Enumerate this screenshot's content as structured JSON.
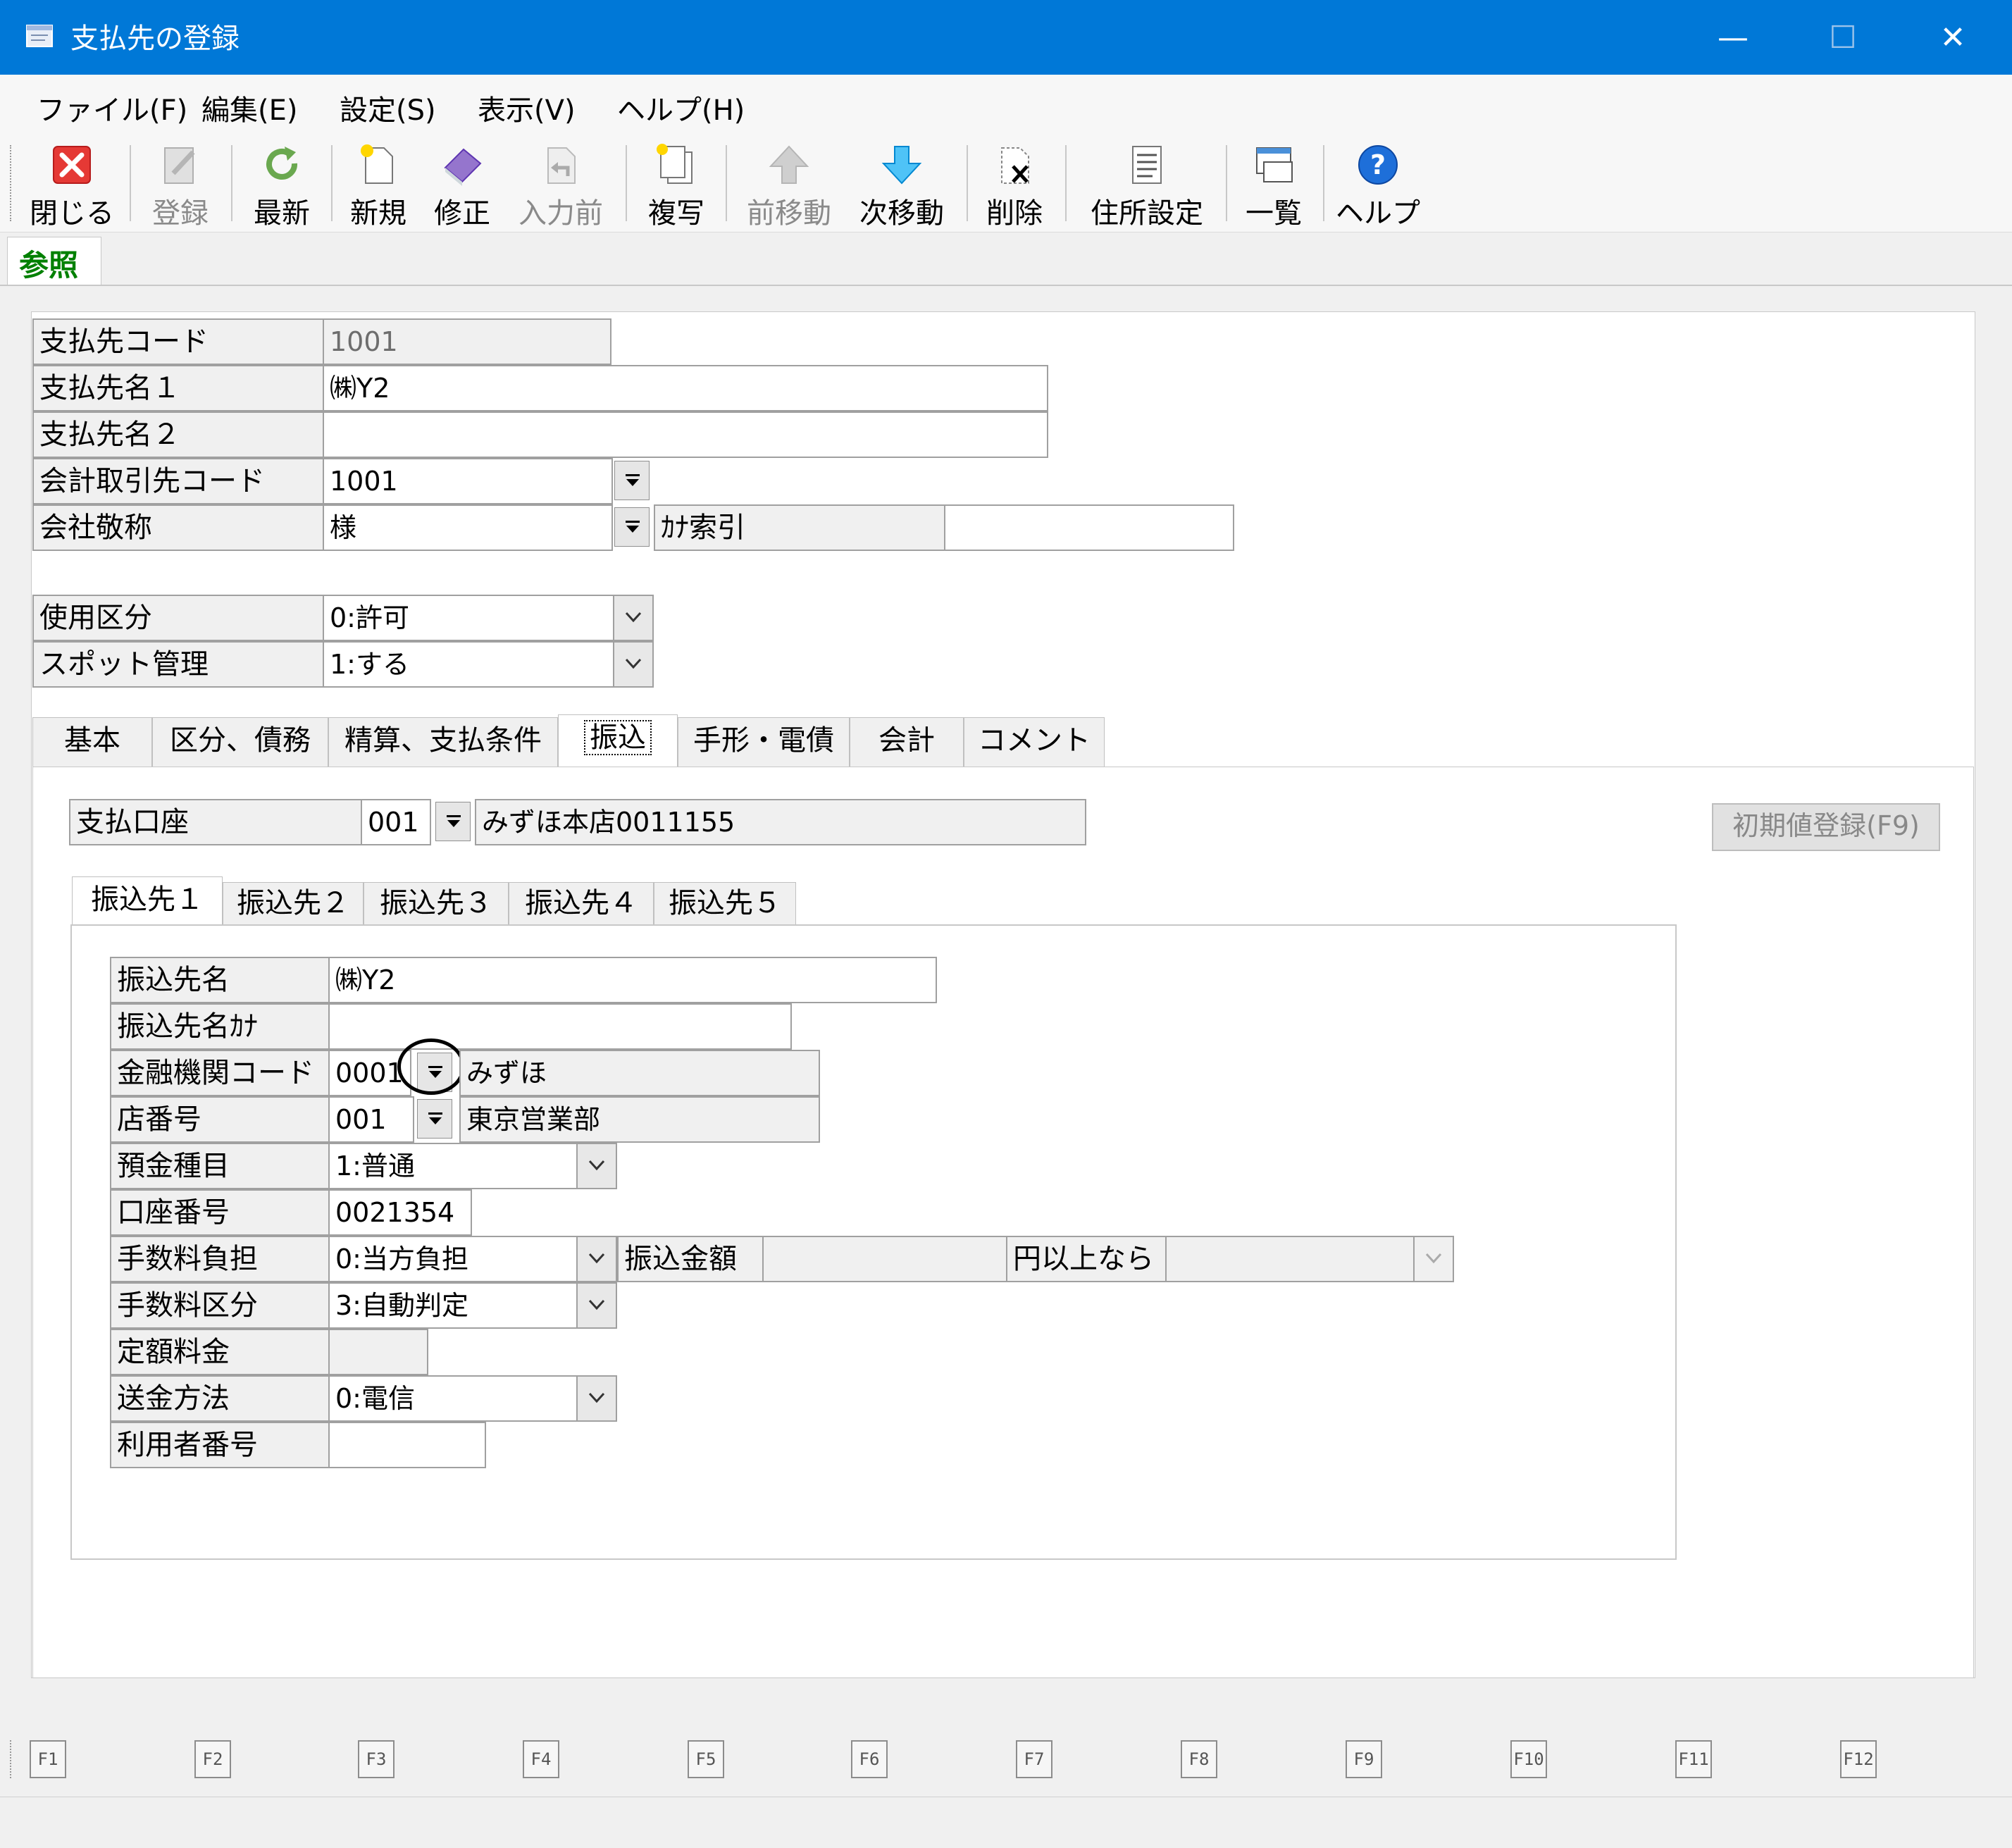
{
  "window": {
    "title": "支払先の登録",
    "minimize": "—",
    "maximize": "☐",
    "close": "✕"
  },
  "menu": [
    {
      "label": "ファイル(F)"
    },
    {
      "label": "編集(E)"
    },
    {
      "label": "設定(S)"
    },
    {
      "label": "表示(V)"
    },
    {
      "label": "ヘルプ(H)"
    }
  ],
  "toolbar": [
    {
      "label": "閉じる",
      "icon": "close-icon",
      "enabled": true
    },
    {
      "label": "登録",
      "icon": "register-icon",
      "enabled": false
    },
    {
      "label": "最新",
      "icon": "refresh-icon",
      "enabled": true
    },
    {
      "label": "新規",
      "icon": "new-document-icon",
      "enabled": true
    },
    {
      "label": "修正",
      "icon": "eraser-icon",
      "enabled": true
    },
    {
      "label": "入力前",
      "icon": "undo-document-icon",
      "enabled": false
    },
    {
      "label": "複写",
      "icon": "copy-icon",
      "enabled": true
    },
    {
      "label": "前移動",
      "icon": "arrow-up-icon",
      "enabled": false
    },
    {
      "label": "次移動",
      "icon": "arrow-down-icon",
      "enabled": true
    },
    {
      "label": "削除",
      "icon": "delete-icon",
      "enabled": true
    },
    {
      "label": "住所設定",
      "icon": "address-list-icon",
      "enabled": true
    },
    {
      "label": "一覧",
      "icon": "list-window-icon",
      "enabled": true
    },
    {
      "label": "ヘルプ",
      "icon": "help-icon",
      "enabled": true
    }
  ],
  "mode": "参照",
  "header_form": {
    "payee_code": {
      "label": "支払先コード",
      "value": "1001"
    },
    "payee_name1": {
      "label": "支払先名１",
      "value": "㈱Y2"
    },
    "payee_name2": {
      "label": "支払先名２",
      "value": ""
    },
    "accounting_partner_code": {
      "label": "会計取引先コード",
      "value": "1001"
    },
    "company_honorific": {
      "label": "会社敬称",
      "value": "様"
    },
    "kana_index": {
      "label": "ｶﾅ索引",
      "value": ""
    },
    "usage_class": {
      "label": "使用区分",
      "value": "0:許可"
    },
    "spot_management": {
      "label": "スポット管理",
      "value": "1:する"
    }
  },
  "main_tabs": [
    {
      "label": "基本"
    },
    {
      "label": "区分、債務"
    },
    {
      "label": "精算、支払条件"
    },
    {
      "label": "振込",
      "selected": true
    },
    {
      "label": "手形・電債"
    },
    {
      "label": "会計"
    },
    {
      "label": "コメント"
    }
  ],
  "payment_account": {
    "label": "支払口座",
    "code": "001",
    "name": "みずほ本店0011155"
  },
  "initial_register_button": "初期値登録(F9)",
  "sub_tabs": [
    {
      "label": "振込先１",
      "selected": true
    },
    {
      "label": "振込先２"
    },
    {
      "label": "振込先３"
    },
    {
      "label": "振込先４"
    },
    {
      "label": "振込先５"
    }
  ],
  "transfer_form": {
    "transfer_name": {
      "label": "振込先名",
      "value": "㈱Y2"
    },
    "transfer_name_kana": {
      "label": "振込先名ｶﾅ",
      "value": ""
    },
    "bank_code": {
      "label": "金融機関コード",
      "value": "0001",
      "name": "みずほ"
    },
    "branch_no": {
      "label": "店番号",
      "value": "001",
      "name": "東京営業部"
    },
    "deposit_type": {
      "label": "預金種目",
      "value": "1:普通"
    },
    "account_no": {
      "label": "口座番号",
      "value": "0021354"
    },
    "fee_burden": {
      "label": "手数料負担",
      "value": "0:当方負担"
    },
    "transfer_amount": {
      "label": "振込金額",
      "value": ""
    },
    "above_yen": {
      "label": "円以上なら",
      "value": ""
    },
    "fee_class": {
      "label": "手数料区分",
      "value": "3:自動判定"
    },
    "fixed_fee": {
      "label": "定額料金",
      "value": ""
    },
    "remit_method": {
      "label": "送金方法",
      "value": "0:電信"
    },
    "user_no": {
      "label": "利用者番号",
      "value": ""
    }
  },
  "function_keys": [
    "F1",
    "F2",
    "F3",
    "F4",
    "F5",
    "F6",
    "F7",
    "F8",
    "F9",
    "F10",
    "F11",
    "F12"
  ],
  "colors": {
    "titlebar": "#0078d7",
    "mode_text": "#008000",
    "accent": "#0078d7"
  }
}
